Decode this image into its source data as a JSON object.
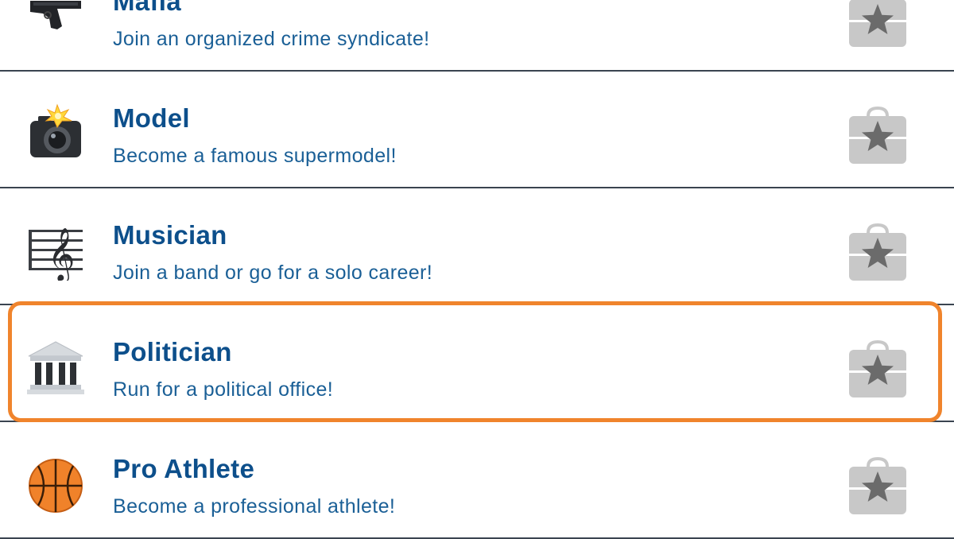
{
  "careers": [
    {
      "title": "Mafia",
      "description": "Join an organized crime syndicate!",
      "icon": "pistol-icon"
    },
    {
      "title": "Model",
      "description": "Become a famous supermodel!",
      "icon": "camera-flash-icon"
    },
    {
      "title": "Musician",
      "description": "Join a band or go for a solo career!",
      "icon": "musical-score-icon"
    },
    {
      "title": "Politician",
      "description": "Run for a political office!",
      "icon": "classical-building-icon"
    },
    {
      "title": "Pro Athlete",
      "description": "Become a professional athlete!",
      "icon": "basketball-icon"
    }
  ],
  "job_button_icon": "briefcase-star-icon",
  "highlighted_item": "Politician",
  "colors": {
    "title": "#0d4f8b",
    "description": "#1a5f96",
    "divider": "#3a4450",
    "highlight": "#f0842c",
    "briefcase": "#c8c8c8",
    "star": "#6b6b6b"
  }
}
